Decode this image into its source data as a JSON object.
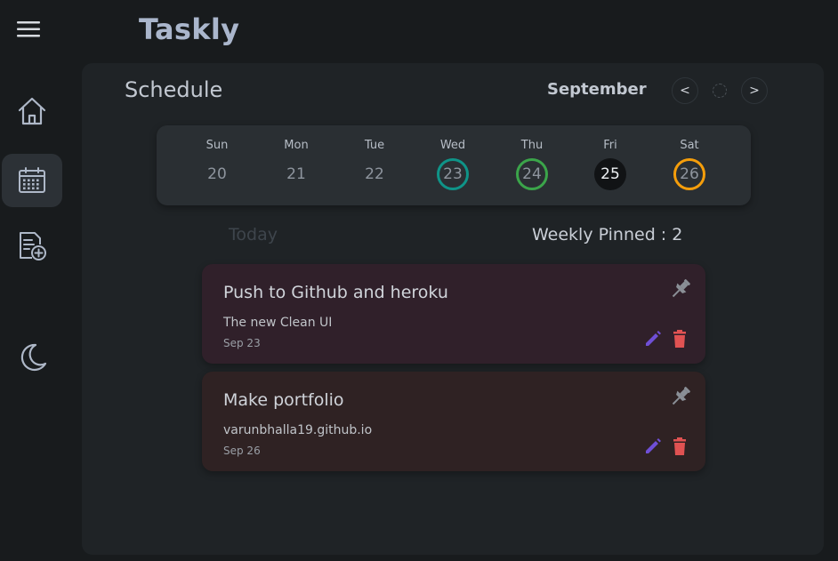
{
  "app": {
    "title": "Taskly"
  },
  "sidebar": {
    "items": [
      {
        "id": "home",
        "icon": "home-icon",
        "active": false
      },
      {
        "id": "schedule",
        "icon": "calendar-icon",
        "active": true
      },
      {
        "id": "add-task",
        "icon": "add-task-icon",
        "active": false
      },
      {
        "id": "theme",
        "icon": "moon-icon",
        "active": false
      }
    ]
  },
  "schedule": {
    "title": "Schedule",
    "month": "September",
    "prev_label": "<",
    "next_label": ">"
  },
  "week": {
    "days": [
      {
        "name": "Sun",
        "date": "20",
        "style": "plain"
      },
      {
        "name": "Mon",
        "date": "21",
        "style": "plain"
      },
      {
        "name": "Tue",
        "date": "22",
        "style": "plain"
      },
      {
        "name": "Wed",
        "date": "23",
        "style": "ring",
        "color": "#0f9488"
      },
      {
        "name": "Thu",
        "date": "24",
        "style": "ring",
        "color": "#3ba54a"
      },
      {
        "name": "Fri",
        "date": "25",
        "style": "selected"
      },
      {
        "name": "Sat",
        "date": "26",
        "style": "ring",
        "color": "#f59e0b"
      }
    ]
  },
  "filters": {
    "today_label": "Today",
    "pinned_label": "Weekly Pinned : 2"
  },
  "tasks": [
    {
      "title": "Push to Github and heroku",
      "description": "The new Clean UI",
      "date": "Sep 23",
      "background": "#30202a"
    },
    {
      "title": "Make portfolio",
      "description": "varunbhalla19.github.io",
      "date": "Sep 26",
      "background": "#2f2223"
    }
  ],
  "colors": {
    "edit": "#6f4fd6",
    "delete": "#e05252",
    "pin": "#8a8f96"
  }
}
